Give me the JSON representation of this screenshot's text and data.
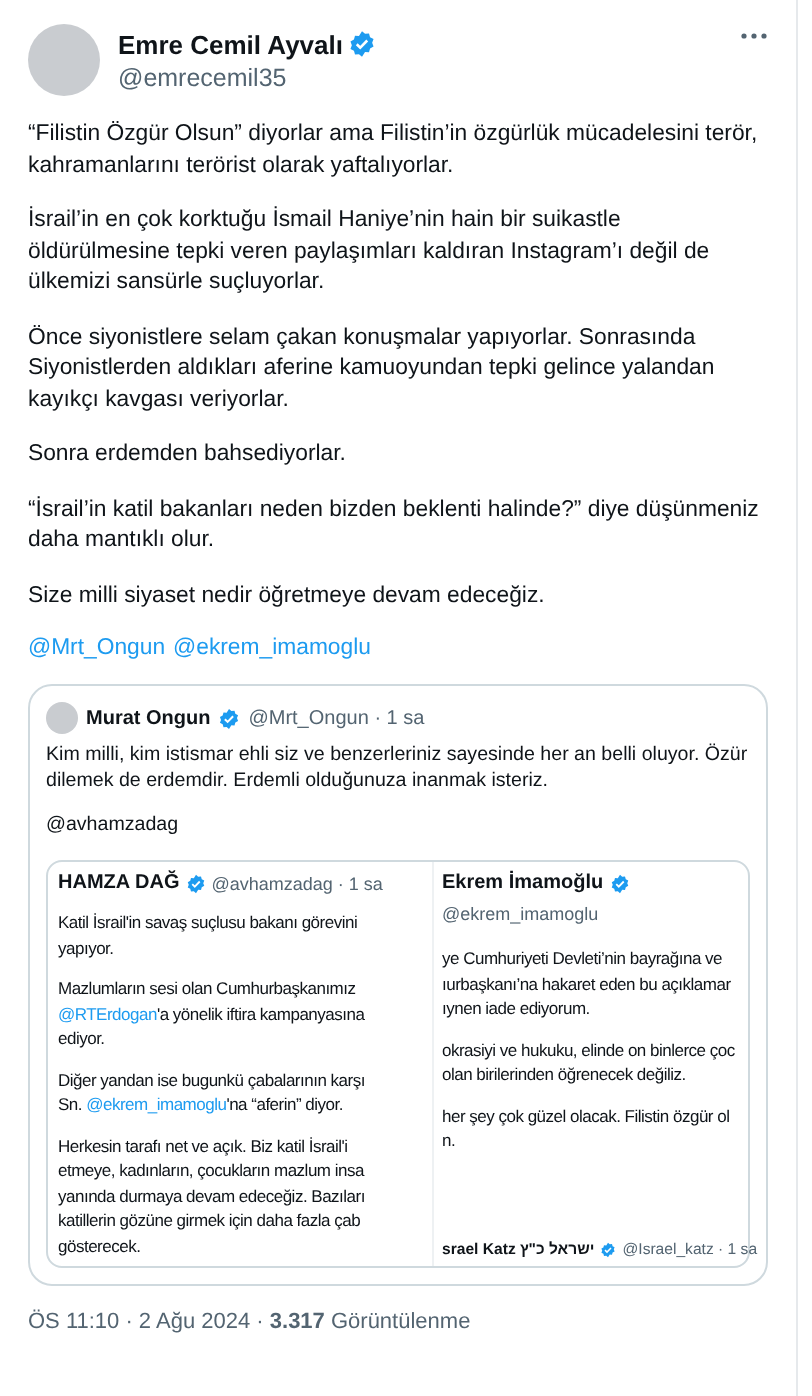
{
  "author": {
    "name": "Emre Cemil Ayvalı",
    "handle": "@emrecemil35",
    "verified": true
  },
  "paragraphs": [
    "“Filistin Özgür Olsun” diyorlar ama Filistin’in özgürlük mücadelesini terör, kahramanlarını terörist olarak yaftalıyorlar.",
    "İsrail’in en çok korktuğu İsmail Haniye’nin hain bir suikastle öldürülmesine tepki veren paylaşımları kaldıran Instagram’ı değil de ülkemizi sansürle suçluyorlar.",
    "Önce siyonistlere selam çakan konuşmalar yapıyorlar. Sonrasında Siyonistlerden aldıkları aferine kamuoyundan tepki gelince yalandan kayıkçı kavgası veriyorlar.",
    "Sonra erdemden bahsediyorlar.",
    "“İsrail’in katil bakanları neden bizden beklenti halinde?” diye düşünmeniz daha mantıklı olur.",
    "Size milli siyaset nedir öğretmeye devam edeceğiz."
  ],
  "mentions": [
    "@Mrt_Ongun",
    "@ekrem_imamoglu"
  ],
  "quote": {
    "author": {
      "name": "Murat Ongun",
      "handle": "@Mrt_Ongun",
      "verified": true
    },
    "time": "· 1 sa",
    "paragraphs": [
      "Kim milli, kim istismar ehli siz ve benzerleriniz sayesinde her an belli oluyor. Özür dilemek de erdemdir. Erdemli olduğunuza inanmak isteriz.",
      "@avhamzadag"
    ],
    "left_post": {
      "name": "HAMZA DAĞ",
      "handle": "@avhamzadag",
      "time": "· 1 sa",
      "verified": true,
      "paragraphs": [
        [
          [
            {
              "text": "Katil İsrail'in savaş suçlusu bakanı görevini",
              "link": false
            }
          ],
          [
            {
              "text": "yapıyor.",
              "link": false
            }
          ]
        ],
        [
          [
            {
              "text": "Mazlumların sesi olan Cumhurbaşkanımız",
              "link": false
            }
          ],
          [
            {
              "text": "@RTErdogan",
              "link": true
            },
            {
              "text": "'a yönelik iftira kampanyasına",
              "link": false
            }
          ],
          [
            {
              "text": "ediyor.",
              "link": false
            }
          ]
        ],
        [
          [
            {
              "text": "Diğer yandan ise bugunkü çabalarının karşı",
              "link": false
            }
          ],
          [
            {
              "text": "Sn. ",
              "link": false
            },
            {
              "text": "@ekrem_imamoglu",
              "link": true
            },
            {
              "text": "'na “aferin” diyor.",
              "link": false
            }
          ]
        ],
        [
          [
            {
              "text": "Herkesin tarafı net ve açık. Biz katil İsrail'i",
              "link": false
            }
          ],
          [
            {
              "text": "etmeye, kadınların, çocukların mazlum insa",
              "link": false
            }
          ],
          [
            {
              "text": "yanında durmaya devam edeceğiz. Bazıları",
              "link": false
            }
          ],
          [
            {
              "text": "katillerin gözüne girmek için daha fazla çab",
              "link": false
            }
          ],
          [
            {
              "text": "gösterecek.",
              "link": false
            }
          ]
        ]
      ]
    },
    "right_post": {
      "name": "Ekrem İmamoğlu",
      "handle": "@ekrem_imamoglu",
      "verified": true,
      "paragraphs": [
        [
          "ye Cumhuriyeti Devleti’nin bayrağına ve",
          "ıurbaşkanı’na hakaret eden bu açıklamar",
          "ıynen iade ediyorum."
        ],
        [
          "okrasiyi ve hukuku, elinde on binlerce çoc",
          "olan birilerinden öğrenecek değiliz."
        ],
        [
          "her şey çok güzel olacak. Filistin özgür ol",
          "n."
        ]
      ],
      "next_post": {
        "name": "srael Katz",
        "name_hebrew": "ישראל כ\"ץ",
        "handle": "@Israel_katz",
        "time": "· 1 sa",
        "verified": true
      }
    }
  },
  "footer": "ÖS 11:10 · 2 Ağu 2024 · **3.317** Görüntülenme"
}
